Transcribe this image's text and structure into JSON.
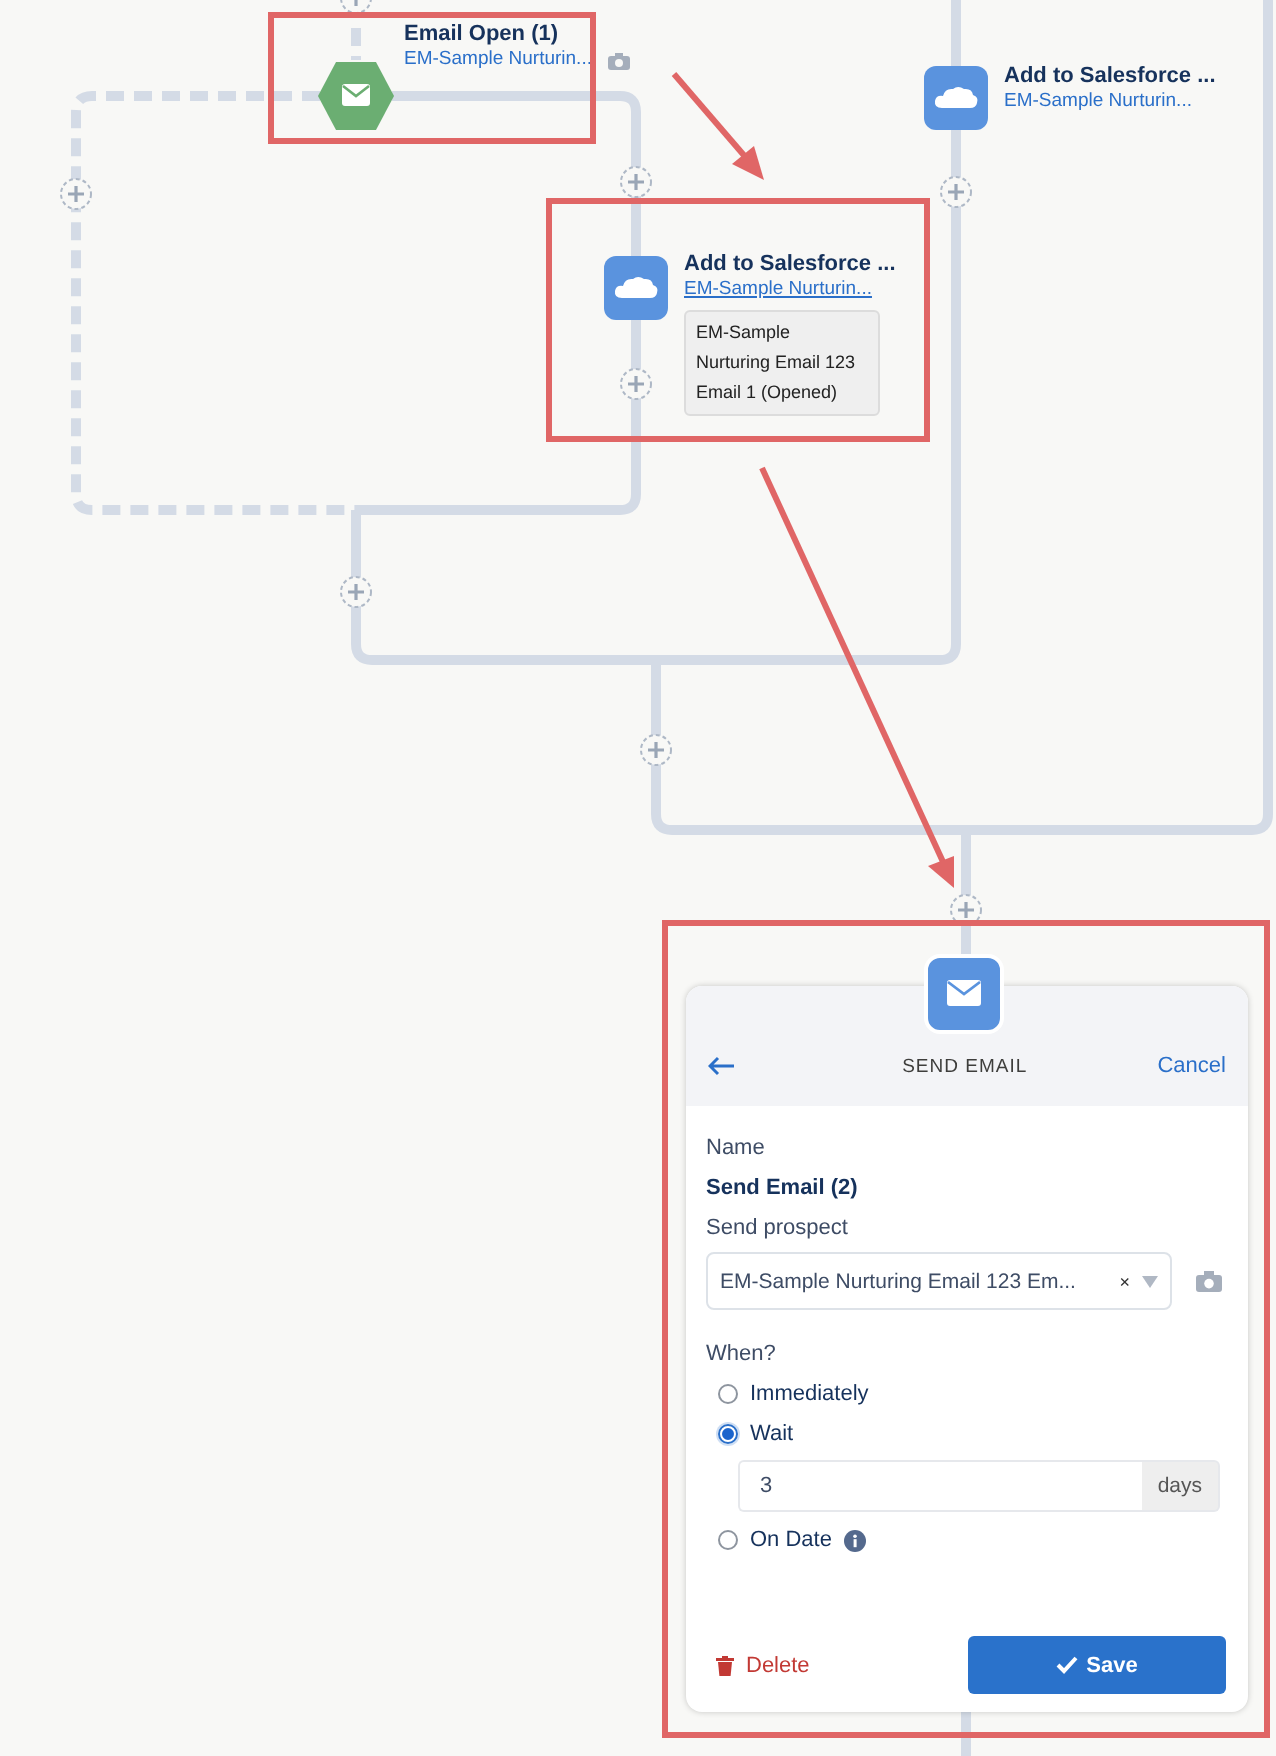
{
  "nodes": [
    {
      "kind": "trigger",
      "title": "Email Open (1)",
      "link": "EM-Sample Nurturin...",
      "camera": true
    },
    {
      "kind": "action",
      "title": "Add to Salesforce ...",
      "link": "EM-Sample Nurturin...",
      "details": [
        "EM-Sample",
        "Nurturing Email 123",
        "Email 1 (Opened)"
      ]
    },
    {
      "kind": "action",
      "title": "Add to Salesforce ...",
      "link": "EM-Sample Nurturin..."
    }
  ],
  "editor": {
    "title": "SEND EMAIL",
    "cancel": "Cancel",
    "name_label": "Name",
    "name_value": "Send Email (2)",
    "prospect_label": "Send prospect",
    "prospect_value": "EM-Sample Nurturing Email 123 Em...",
    "clear": "×",
    "when_label": "When?",
    "options": [
      {
        "label": "Immediately",
        "selected": false
      },
      {
        "label": "Wait",
        "selected": true,
        "wait_value": "3",
        "unit": "days"
      },
      {
        "label": "On Date",
        "selected": false,
        "info": true
      }
    ],
    "delete": "Delete",
    "save": "Save"
  }
}
